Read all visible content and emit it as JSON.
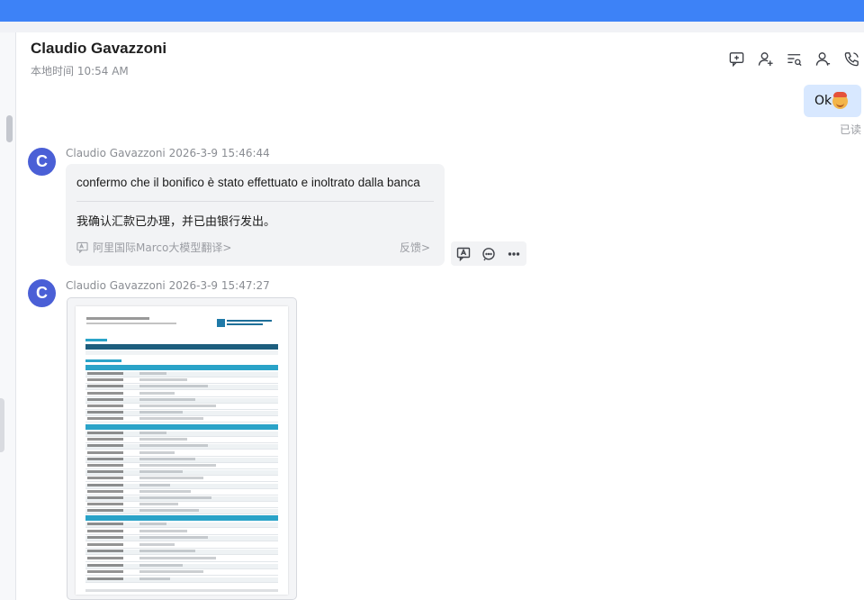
{
  "header": {
    "contact_name": "Claudio Gavazzoni",
    "local_time": "本地时间 10:54 AM"
  },
  "toolbar": {
    "icons": [
      "comment-plus-icon",
      "add-person-icon",
      "search-list-icon",
      "person-icon",
      "phone-icon"
    ]
  },
  "messages": {
    "outgoing": {
      "text": "Ok",
      "status": "已读"
    },
    "incoming_1": {
      "sender": "Claudio Gavazzoni",
      "timestamp": "2026-3-9 15:46:44",
      "original": "confermo che il bonifico è stato effettuato e inoltrato dalla banca",
      "translation": "我确认汇款已办理，并已由银行发出。",
      "engine": "阿里国际Marco大模型翻译>",
      "feedback": "反馈>"
    },
    "incoming_2": {
      "sender": "Claudio Gavazzoni",
      "timestamp": "2026-3-9 15:47:27"
    }
  },
  "avatar_letter": "C",
  "colors": {
    "accent": "#3d82f7",
    "avatar": "#4a5fd6",
    "outgoing_bubble": "#d8e8ff",
    "incoming_bubble": "#f2f3f5"
  }
}
